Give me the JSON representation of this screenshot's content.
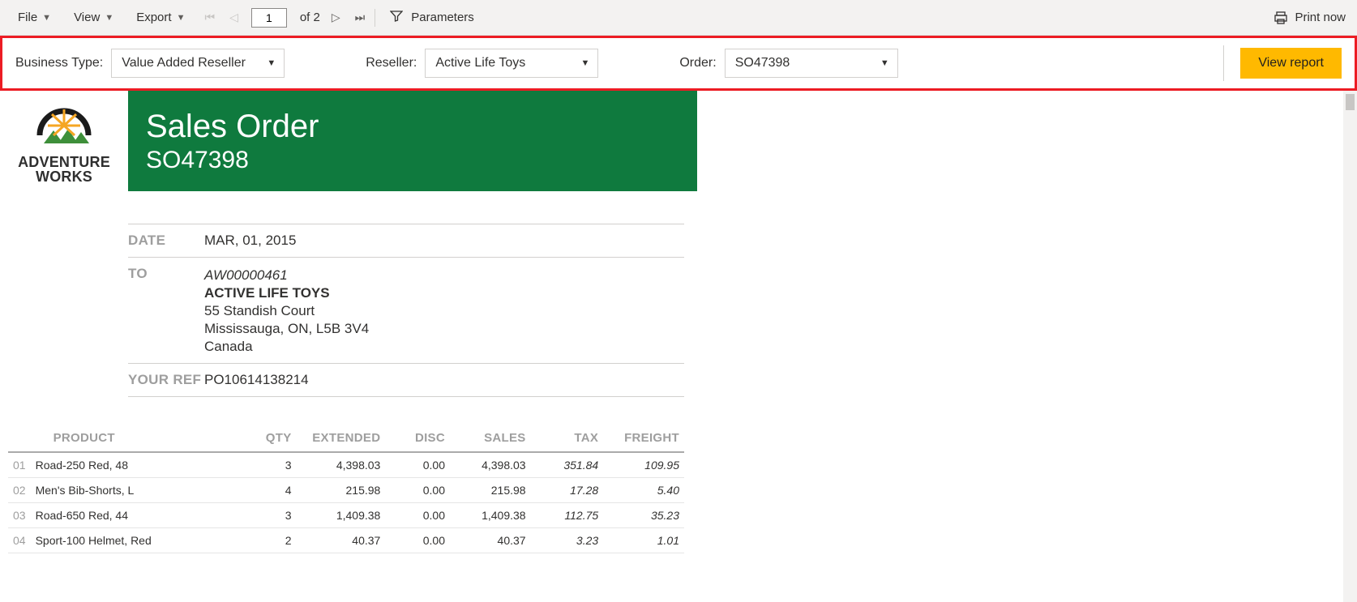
{
  "toolbar": {
    "file": "File",
    "view": "View",
    "export": "Export",
    "page_current": "1",
    "page_total": "of 2",
    "parameters": "Parameters",
    "print": "Print now"
  },
  "params": {
    "business_type_label": "Business Type:",
    "business_type_value": "Value Added Reseller",
    "reseller_label": "Reseller:",
    "reseller_value": "Active Life Toys",
    "order_label": "Order:",
    "order_value": "SO47398",
    "view_report": "View report"
  },
  "logo": {
    "line1": "ADVENTURE",
    "line2": "WORKS"
  },
  "report": {
    "title": "Sales Order",
    "so_number": "SO47398",
    "date_label": "DATE",
    "date_value": "MAR, 01, 2015",
    "to_label": "TO",
    "to_code": "AW00000461",
    "to_name": "ACTIVE LIFE TOYS",
    "to_addr1": "55 Standish Court",
    "to_addr2": "Mississauga, ON, L5B 3V4",
    "to_country": "Canada",
    "ref_label": "YOUR REF",
    "ref_value": "PO10614138214"
  },
  "table": {
    "headers": {
      "product": "PRODUCT",
      "qty": "QTY",
      "extended": "EXTENDED",
      "disc": "DISC",
      "sales": "SALES",
      "tax": "TAX",
      "freight": "FREIGHT"
    },
    "rows": [
      {
        "n": "01",
        "product": "Road-250 Red, 48",
        "qty": "3",
        "extended": "4,398.03",
        "disc": "0.00",
        "sales": "4,398.03",
        "tax": "351.84",
        "freight": "109.95"
      },
      {
        "n": "02",
        "product": "Men's Bib-Shorts, L",
        "qty": "4",
        "extended": "215.98",
        "disc": "0.00",
        "sales": "215.98",
        "tax": "17.28",
        "freight": "5.40"
      },
      {
        "n": "03",
        "product": "Road-650 Red, 44",
        "qty": "3",
        "extended": "1,409.38",
        "disc": "0.00",
        "sales": "1,409.38",
        "tax": "112.75",
        "freight": "35.23"
      },
      {
        "n": "04",
        "product": "Sport-100 Helmet, Red",
        "qty": "2",
        "extended": "40.37",
        "disc": "0.00",
        "sales": "40.37",
        "tax": "3.23",
        "freight": "1.01"
      }
    ]
  }
}
